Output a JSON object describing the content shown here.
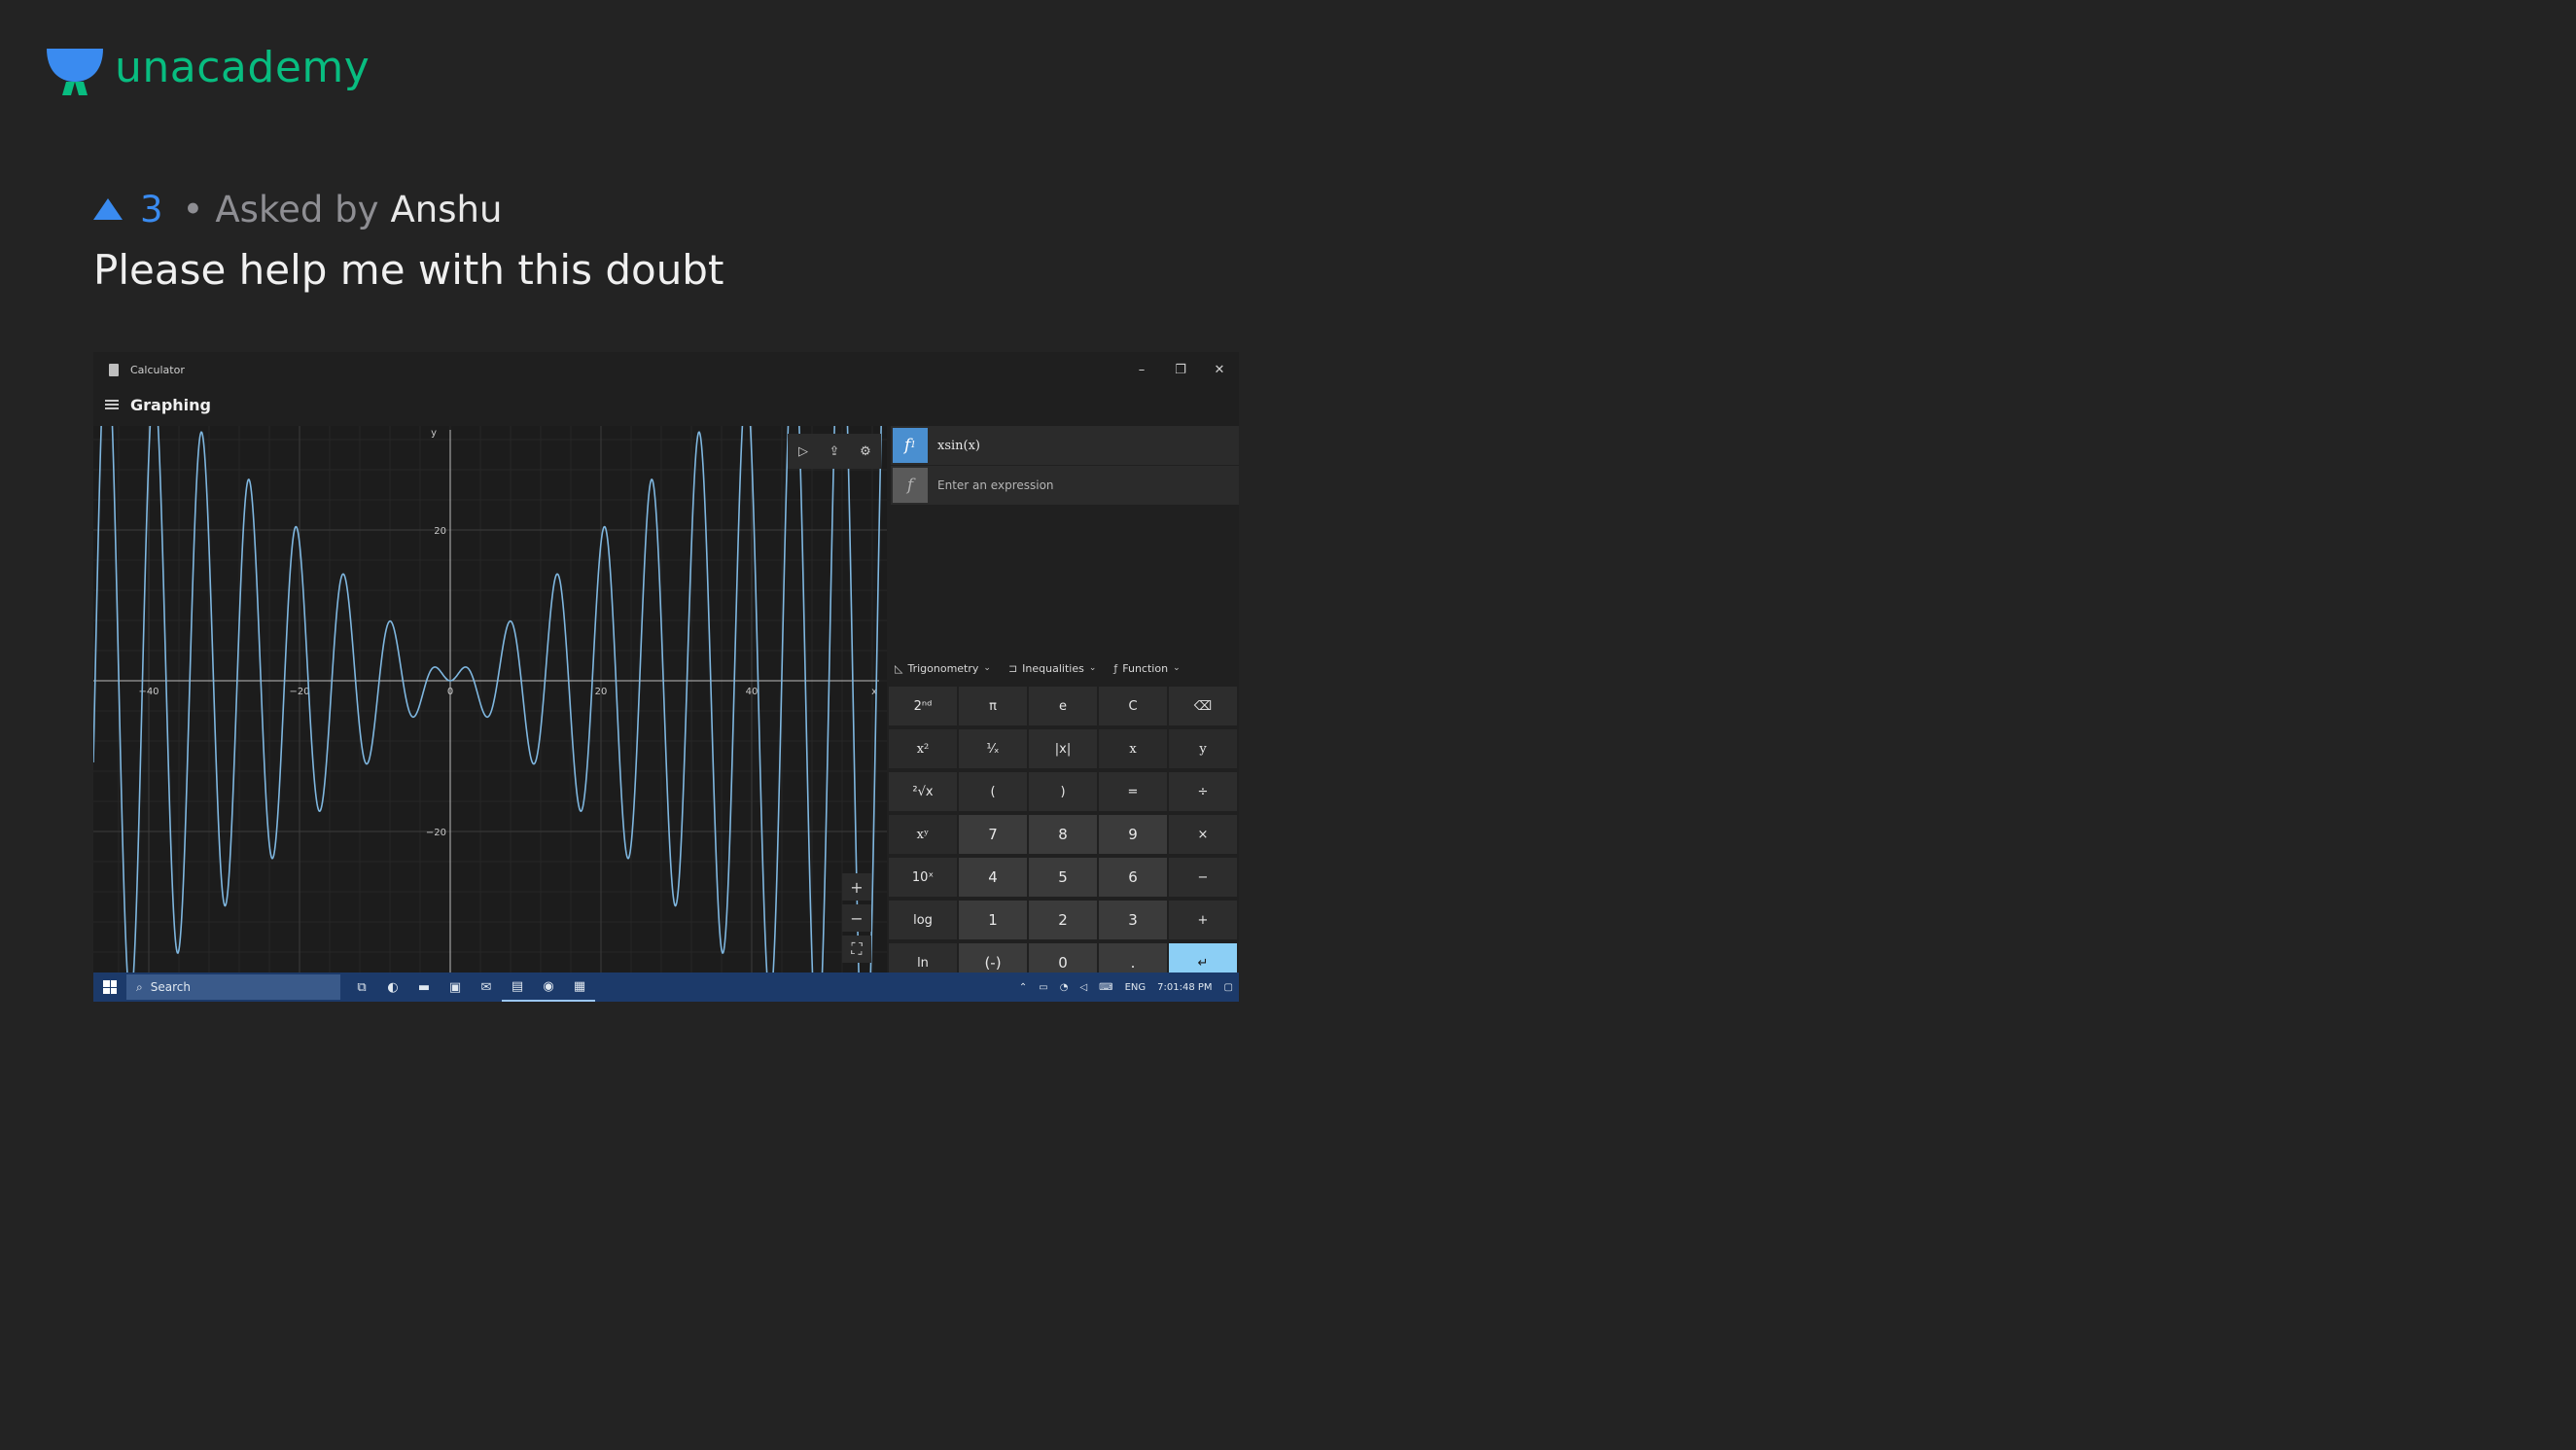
{
  "brand": {
    "name": "unacademy"
  },
  "question": {
    "upvotes": "3",
    "separator": "•",
    "asked_by_label": "Asked by",
    "author": "Anshu",
    "text": "Please help me with this doubt"
  },
  "calculator": {
    "window_title": "Calculator",
    "mode": "Graphing",
    "window_controls": {
      "minimize": "–",
      "restore": "❐",
      "close": "✕"
    },
    "graph": {
      "function": "x·sin(x)",
      "x_ticks": [
        "−40",
        "−20",
        "0",
        "20",
        "40"
      ],
      "y_ticks": [
        "20",
        "−20"
      ],
      "x_axis_label": "x",
      "y_axis_label": "y",
      "tools": {
        "trace": "▷",
        "share": "⇪",
        "settings": "⚙"
      },
      "zoom": {
        "in": "+",
        "out": "−",
        "fit": "⛶"
      },
      "line_color": "#7fb7e0"
    },
    "functions": [
      {
        "symbol": "f",
        "subscript": "1",
        "expression": "xsin(x)"
      },
      {
        "symbol": "f",
        "placeholder": "Enter an expression"
      }
    ],
    "menus": [
      {
        "icon": "◺",
        "label": "Trigonometry"
      },
      {
        "icon": "⊐",
        "label": "Inequalities"
      },
      {
        "icon": "ƒ",
        "label": "Function"
      }
    ],
    "keys": [
      [
        "2ⁿᵈ",
        "π",
        "e",
        "C",
        "⌫"
      ],
      [
        "x²",
        "¹⁄ₓ",
        "|x|",
        "x",
        "y"
      ],
      [
        "²√x",
        "(",
        ")",
        "=",
        "÷"
      ],
      [
        "xʸ",
        "7",
        "8",
        "9",
        "×"
      ],
      [
        "10ˣ",
        "4",
        "5",
        "6",
        "−"
      ],
      [
        "log",
        "1",
        "2",
        "3",
        "+"
      ],
      [
        "ln",
        "(-)",
        "0",
        ".",
        "↵"
      ]
    ]
  },
  "taskbar": {
    "search_placeholder": "Search",
    "tray": {
      "language": "ENG",
      "time": "7:01:48 PM"
    }
  }
}
